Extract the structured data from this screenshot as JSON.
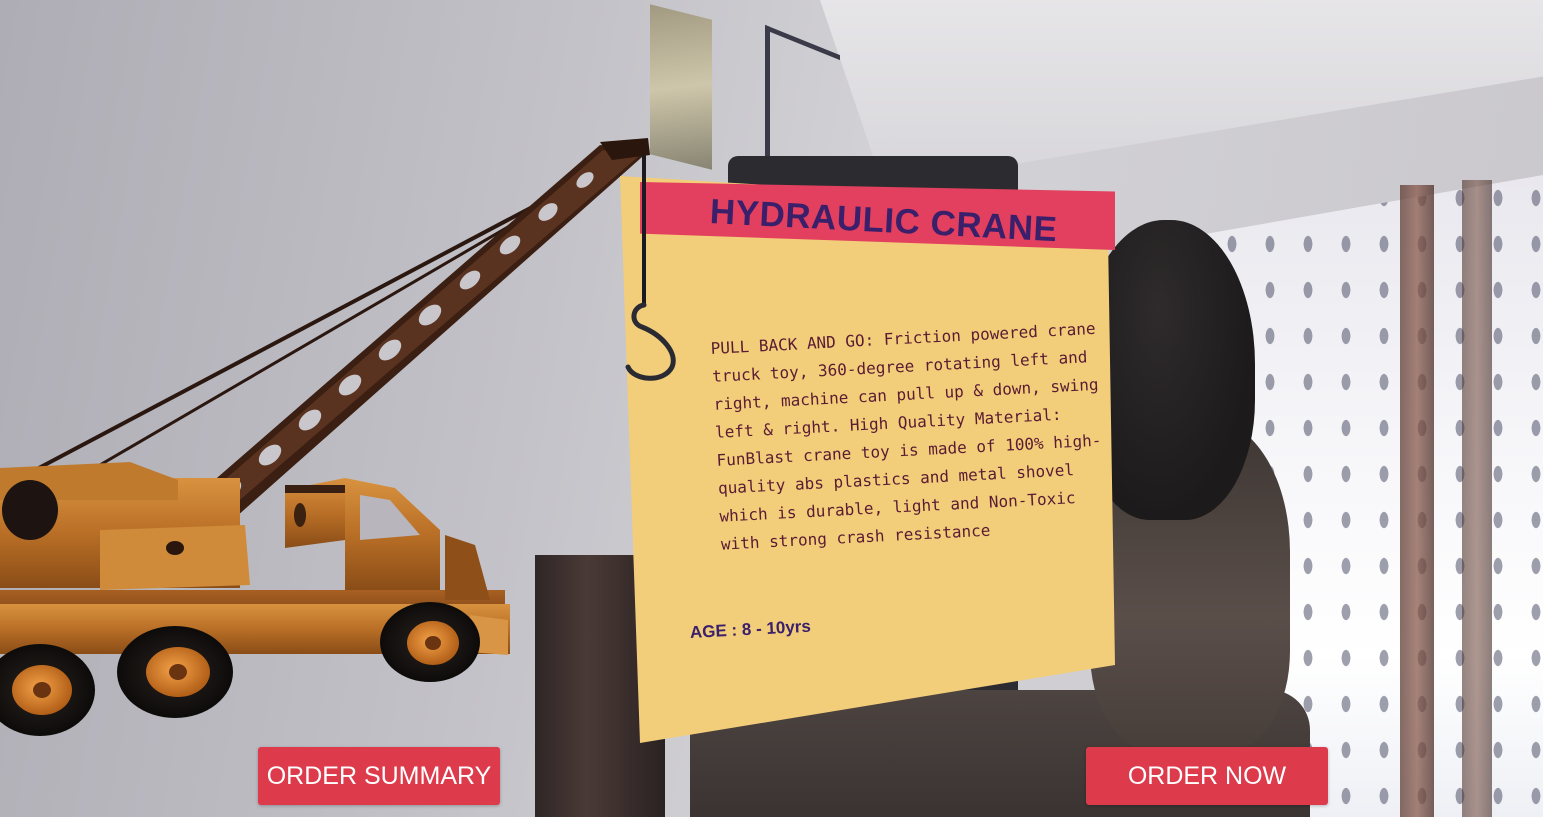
{
  "product": {
    "title": "HYDRAULIC CRANE",
    "description": "PULL BACK AND GO: Friction powered crane truck toy, 360-degree rotating left and right, machine can pull up & down, swing left & right. High Quality Material: FunBlast crane toy is made of 100% high-quality abs plastics and metal shovel which is durable, light and Non-Toxic with strong crash resistance",
    "age_label": "AGE",
    "age_separator": ":",
    "age_value": "8 - 10yrs"
  },
  "actions": {
    "order_summary_label": "ORDER SUMMARY",
    "order_now_label": "ORDER NOW"
  },
  "colors": {
    "button_bg": "#dd3a4b",
    "card_bg": "#f2cd7a",
    "title_bar": "#e2405e",
    "title_text": "#3a1f6b"
  },
  "icons": {
    "hook": "crane-hook-icon"
  }
}
